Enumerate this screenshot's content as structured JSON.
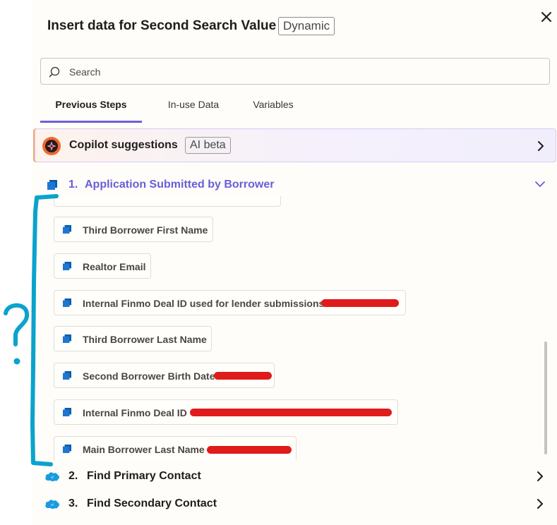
{
  "header": {
    "title": "Insert data for Second Search Value",
    "badge": "Dynamic",
    "close_icon": "close-icon"
  },
  "search": {
    "placeholder": "Search",
    "value": ""
  },
  "tabs": [
    {
      "label": "Previous Steps",
      "active": true
    },
    {
      "label": "In-use Data",
      "active": false
    },
    {
      "label": "Variables",
      "active": false
    }
  ],
  "copilot": {
    "title": "Copilot suggestions",
    "badge": "AI beta"
  },
  "steps": [
    {
      "number": "1.",
      "title": "Application Submitted by Borrower",
      "expanded": true,
      "icon": "app-square-icon",
      "items": [
        {
          "label": "Third Borrower First Name"
        },
        {
          "label": "Realtor Email"
        },
        {
          "label": "Internal Finmo Deal ID used for lender submissions"
        },
        {
          "label": "Third Borrower Last Name"
        },
        {
          "label": "Second Borrower Birth Date"
        },
        {
          "label": "Internal Finmo Deal ID"
        },
        {
          "label": "Main Borrower Last Name"
        }
      ]
    },
    {
      "number": "2.",
      "title": "Find Primary Contact",
      "expanded": false,
      "icon": "salesforce-icon"
    },
    {
      "number": "3.",
      "title": "Find Secondary Contact",
      "expanded": false,
      "icon": "salesforce-icon"
    }
  ],
  "annotation": {
    "symbol": "?",
    "color": "#0aa3cc"
  },
  "colors": {
    "accent": "#6b5fdc",
    "redaction": "#e01b1b",
    "app_icon": "#0b5cab",
    "salesforce": "#1a9be0"
  }
}
